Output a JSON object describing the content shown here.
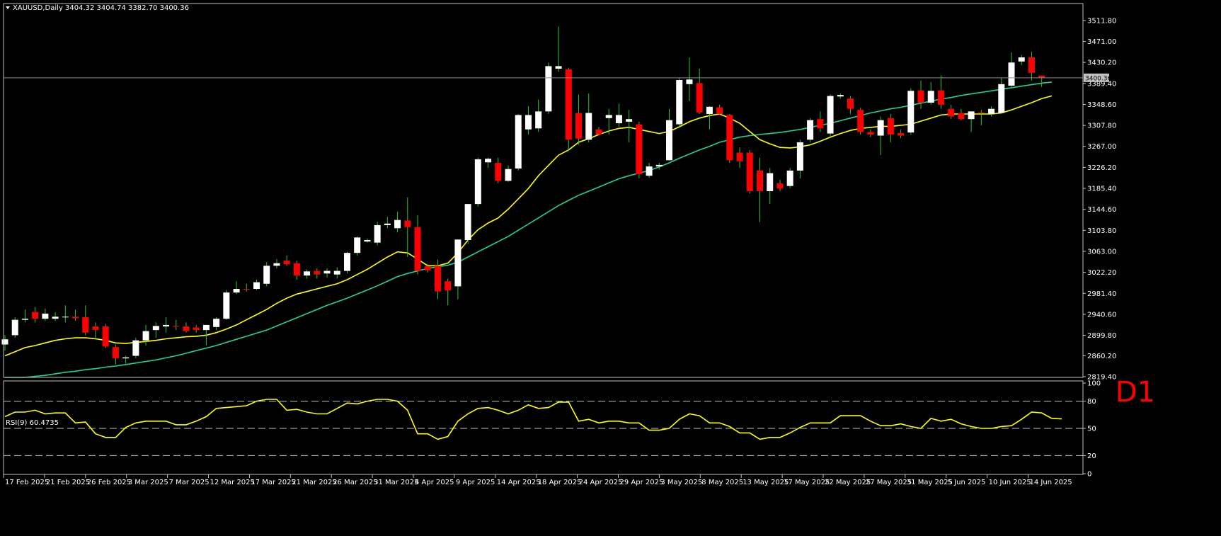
{
  "header": {
    "symbol": "XAUUSD,Daily",
    "ohlc": "3404.32 3404.74 3382.70 3400.36",
    "arrow_icon": "triangle-down-icon"
  },
  "timeframe_label": "D1",
  "current_price_label": "3400.36",
  "colors": {
    "background": "#000000",
    "bull_candle": "#ffffff",
    "bear_candle": "#ff0000",
    "wick": "#22cc22",
    "ma_fast": "#ffff00",
    "ma_slow": "#20d0a0",
    "rsi_line": "#ffff00",
    "grid_dash": "#c0c0c0",
    "border": "#c0c0c0",
    "timeframe_text": "#ff0000"
  },
  "chart_data": {
    "type": "candlestick",
    "title": "XAUUSD,Daily",
    "ylim": [
      2819.4,
      3524.0
    ],
    "y_ticks": [
      "3511.80",
      "3471.00",
      "3430.20",
      "3389.40",
      "3348.60",
      "3307.80",
      "3267.00",
      "3226.20",
      "3185.40",
      "3144.60",
      "3103.80",
      "3063.00",
      "3022.20",
      "2981.40",
      "2940.60",
      "2899.80",
      "2860.20",
      "2819.40"
    ],
    "x_ticks": [
      "17 Feb 2025",
      "21 Feb 2025",
      "26 Feb 2025",
      "3 Mar 2025",
      "7 Mar 2025",
      "12 Mar 2025",
      "17 Mar 2025",
      "21 Mar 2025",
      "26 Mar 2025",
      "31 Mar 2025",
      "4 Apr 2025",
      "9 Apr 2025",
      "14 Apr 2025",
      "18 Apr 2025",
      "24 Apr 2025",
      "29 Apr 2025",
      "3 May 2025",
      "8 May 2025",
      "13 May 2025",
      "17 May 2025",
      "22 May 2025",
      "27 May 2025",
      "31 May 2025",
      "5 Jun 2025",
      "10 Jun 2025",
      "14 Jun 2025"
    ],
    "candles": [
      {
        "o": 2882,
        "h": 2900,
        "l": 2870,
        "c": 2892
      },
      {
        "o": 2900,
        "h": 2935,
        "l": 2895,
        "c": 2930
      },
      {
        "o": 2930,
        "h": 2950,
        "l": 2925,
        "c": 2932
      },
      {
        "o": 2945,
        "h": 2955,
        "l": 2925,
        "c": 2932
      },
      {
        "o": 2932,
        "h": 2952,
        "l": 2928,
        "c": 2942
      },
      {
        "o": 2932,
        "h": 2945,
        "l": 2928,
        "c": 2936
      },
      {
        "o": 2935,
        "h": 2958,
        "l": 2925,
        "c": 2936
      },
      {
        "o": 2936,
        "h": 2950,
        "l": 2928,
        "c": 2933
      },
      {
        "o": 2935,
        "h": 2958,
        "l": 2900,
        "c": 2905
      },
      {
        "o": 2917,
        "h": 2925,
        "l": 2895,
        "c": 2910
      },
      {
        "o": 2917,
        "h": 2922,
        "l": 2875,
        "c": 2878
      },
      {
        "o": 2877,
        "h": 2882,
        "l": 2843,
        "c": 2855
      },
      {
        "o": 2855,
        "h": 2860,
        "l": 2845,
        "c": 2857
      },
      {
        "o": 2860,
        "h": 2895,
        "l": 2855,
        "c": 2890
      },
      {
        "o": 2890,
        "h": 2920,
        "l": 2880,
        "c": 2908
      },
      {
        "o": 2910,
        "h": 2925,
        "l": 2895,
        "c": 2918
      },
      {
        "o": 2917,
        "h": 2935,
        "l": 2905,
        "c": 2920
      },
      {
        "o": 2918,
        "h": 2930,
        "l": 2910,
        "c": 2917
      },
      {
        "o": 2917,
        "h": 2925,
        "l": 2905,
        "c": 2908
      },
      {
        "o": 2915,
        "h": 2920,
        "l": 2905,
        "c": 2910
      },
      {
        "o": 2910,
        "h": 2920,
        "l": 2880,
        "c": 2920
      },
      {
        "o": 2916,
        "h": 2935,
        "l": 2910,
        "c": 2932
      },
      {
        "o": 2932,
        "h": 2988,
        "l": 2930,
        "c": 2983
      },
      {
        "o": 2983,
        "h": 3005,
        "l": 2980,
        "c": 2990
      },
      {
        "o": 2990,
        "h": 3000,
        "l": 2985,
        "c": 2989
      },
      {
        "o": 2990,
        "h": 3008,
        "l": 2988,
        "c": 3003
      },
      {
        "o": 3000,
        "h": 3042,
        "l": 2995,
        "c": 3035
      },
      {
        "o": 3035,
        "h": 3048,
        "l": 3030,
        "c": 3040
      },
      {
        "o": 3045,
        "h": 3055,
        "l": 3035,
        "c": 3038
      },
      {
        "o": 3040,
        "h": 3045,
        "l": 3008,
        "c": 3016
      },
      {
        "o": 3016,
        "h": 3028,
        "l": 3010,
        "c": 3024
      },
      {
        "o": 3025,
        "h": 3030,
        "l": 3010,
        "c": 3018
      },
      {
        "o": 3020,
        "h": 3030,
        "l": 3012,
        "c": 3025
      },
      {
        "o": 3018,
        "h": 3032,
        "l": 3010,
        "c": 3025
      },
      {
        "o": 3025,
        "h": 3062,
        "l": 3020,
        "c": 3060
      },
      {
        "o": 3060,
        "h": 3092,
        "l": 3055,
        "c": 3090
      },
      {
        "o": 3082,
        "h": 3088,
        "l": 3080,
        "c": 3085
      },
      {
        "o": 3080,
        "h": 3120,
        "l": 3075,
        "c": 3114
      },
      {
        "o": 3114,
        "h": 3130,
        "l": 3108,
        "c": 3117
      },
      {
        "o": 3108,
        "h": 3140,
        "l": 3100,
        "c": 3124
      },
      {
        "o": 3123,
        "h": 3168,
        "l": 3052,
        "c": 3110
      },
      {
        "o": 3110,
        "h": 3133,
        "l": 3018,
        "c": 3025
      },
      {
        "o": 3034,
        "h": 3038,
        "l": 3022,
        "c": 3026
      },
      {
        "o": 3035,
        "h": 3047,
        "l": 2970,
        "c": 2985
      },
      {
        "o": 3005,
        "h": 3010,
        "l": 2958,
        "c": 2987
      },
      {
        "o": 2995,
        "h": 3050,
        "l": 2970,
        "c": 3086
      },
      {
        "o": 3085,
        "h": 3150,
        "l": 3078,
        "c": 3155
      },
      {
        "o": 3155,
        "h": 3245,
        "l": 3150,
        "c": 3242
      },
      {
        "o": 3236,
        "h": 3245,
        "l": 3225,
        "c": 3243
      },
      {
        "o": 3235,
        "h": 3245,
        "l": 3195,
        "c": 3200
      },
      {
        "o": 3200,
        "h": 3230,
        "l": 3198,
        "c": 3223
      },
      {
        "o": 3224,
        "h": 3330,
        "l": 3220,
        "c": 3328
      },
      {
        "o": 3300,
        "h": 3345,
        "l": 3290,
        "c": 3328
      },
      {
        "o": 3302,
        "h": 3358,
        "l": 3295,
        "c": 3335
      },
      {
        "o": 3335,
        "h": 3430,
        "l": 3330,
        "c": 3423
      },
      {
        "o": 3418,
        "h": 3500,
        "l": 3412,
        "c": 3423
      },
      {
        "o": 3417,
        "h": 3420,
        "l": 3260,
        "c": 3280
      },
      {
        "o": 3332,
        "h": 3368,
        "l": 3270,
        "c": 3282
      },
      {
        "o": 3280,
        "h": 3370,
        "l": 3275,
        "c": 3332
      },
      {
        "o": 3300,
        "h": 3305,
        "l": 3290,
        "c": 3290
      },
      {
        "o": 3322,
        "h": 3340,
        "l": 3290,
        "c": 3328
      },
      {
        "o": 3312,
        "h": 3350,
        "l": 3305,
        "c": 3328
      },
      {
        "o": 3315,
        "h": 3338,
        "l": 3275,
        "c": 3320
      },
      {
        "o": 3310,
        "h": 3315,
        "l": 3205,
        "c": 3213
      },
      {
        "o": 3210,
        "h": 3235,
        "l": 3206,
        "c": 3228
      },
      {
        "o": 3228,
        "h": 3235,
        "l": 3222,
        "c": 3231
      },
      {
        "o": 3240,
        "h": 3340,
        "l": 3240,
        "c": 3318
      },
      {
        "o": 3310,
        "h": 3400,
        "l": 3305,
        "c": 3396
      },
      {
        "o": 3388,
        "h": 3440,
        "l": 3355,
        "c": 3397
      },
      {
        "o": 3390,
        "h": 3418,
        "l": 3330,
        "c": 3333
      },
      {
        "o": 3330,
        "h": 3345,
        "l": 3300,
        "c": 3344
      },
      {
        "o": 3343,
        "h": 3348,
        "l": 3329,
        "c": 3330
      },
      {
        "o": 3328,
        "h": 3330,
        "l": 3235,
        "c": 3240
      },
      {
        "o": 3255,
        "h": 3265,
        "l": 3225,
        "c": 3238
      },
      {
        "o": 3255,
        "h": 3260,
        "l": 3175,
        "c": 3180
      },
      {
        "o": 3220,
        "h": 3245,
        "l": 3120,
        "c": 3180
      },
      {
        "o": 3180,
        "h": 3225,
        "l": 3155,
        "c": 3215
      },
      {
        "o": 3195,
        "h": 3202,
        "l": 3180,
        "c": 3185
      },
      {
        "o": 3190,
        "h": 3225,
        "l": 3186,
        "c": 3220
      },
      {
        "o": 3220,
        "h": 3280,
        "l": 3205,
        "c": 3275
      },
      {
        "o": 3280,
        "h": 3322,
        "l": 3275,
        "c": 3318
      },
      {
        "o": 3320,
        "h": 3335,
        "l": 3295,
        "c": 3302
      },
      {
        "o": 3292,
        "h": 3368,
        "l": 3285,
        "c": 3365
      },
      {
        "o": 3364,
        "h": 3370,
        "l": 3360,
        "c": 3367
      },
      {
        "o": 3360,
        "h": 3365,
        "l": 3330,
        "c": 3340
      },
      {
        "o": 3338,
        "h": 3342,
        "l": 3290,
        "c": 3295
      },
      {
        "o": 3295,
        "h": 3300,
        "l": 3285,
        "c": 3290
      },
      {
        "o": 3288,
        "h": 3325,
        "l": 3250,
        "c": 3318
      },
      {
        "o": 3322,
        "h": 3330,
        "l": 3275,
        "c": 3290
      },
      {
        "o": 3293,
        "h": 3300,
        "l": 3283,
        "c": 3288
      },
      {
        "o": 3294,
        "h": 3380,
        "l": 3290,
        "c": 3375
      },
      {
        "o": 3376,
        "h": 3395,
        "l": 3340,
        "c": 3352
      },
      {
        "o": 3352,
        "h": 3392,
        "l": 3348,
        "c": 3375
      },
      {
        "o": 3376,
        "h": 3405,
        "l": 3340,
        "c": 3348
      },
      {
        "o": 3340,
        "h": 3348,
        "l": 3320,
        "c": 3325
      },
      {
        "o": 3332,
        "h": 3340,
        "l": 3318,
        "c": 3320
      },
      {
        "o": 3320,
        "h": 3330,
        "l": 3295,
        "c": 3335
      },
      {
        "o": 3333,
        "h": 3338,
        "l": 3308,
        "c": 3332
      },
      {
        "o": 3330,
        "h": 3345,
        "l": 3325,
        "c": 3340
      },
      {
        "o": 3332,
        "h": 3400,
        "l": 3330,
        "c": 3388
      },
      {
        "o": 3385,
        "h": 3450,
        "l": 3380,
        "c": 3430
      },
      {
        "o": 3432,
        "h": 3445,
        "l": 3425,
        "c": 3440
      },
      {
        "o": 3440,
        "h": 3451,
        "l": 3395,
        "c": 3410
      },
      {
        "o": 3404.32,
        "h": 3404.74,
        "l": 3382.7,
        "c": 3400.36
      }
    ],
    "series": [
      {
        "name": "MA fast",
        "values": [
          2860,
          2868,
          2876,
          2880,
          2885,
          2890,
          2893,
          2895,
          2895,
          2893,
          2890,
          2885,
          2884,
          2886,
          2888,
          2890,
          2893,
          2895,
          2897,
          2898,
          2900,
          2905,
          2912,
          2920,
          2930,
          2940,
          2950,
          2962,
          2972,
          2980,
          2985,
          2990,
          2995,
          3000,
          3008,
          3018,
          3028,
          3040,
          3052,
          3062,
          3060,
          3048,
          3035,
          3035,
          3040,
          3060,
          3085,
          3105,
          3118,
          3128,
          3145,
          3165,
          3185,
          3210,
          3230,
          3250,
          3260,
          3275,
          3282,
          3290,
          3297,
          3302,
          3304,
          3300,
          3296,
          3292,
          3296,
          3305,
          3315,
          3322,
          3327,
          3330,
          3322,
          3312,
          3296,
          3280,
          3272,
          3265,
          3264,
          3266,
          3270,
          3277,
          3285,
          3292,
          3298,
          3302,
          3304,
          3306,
          3306,
          3308,
          3310,
          3316,
          3322,
          3328,
          3330,
          3330,
          3330,
          3330,
          3330,
          3332,
          3338,
          3345,
          3352,
          3360,
          3365
        ]
      },
      {
        "name": "MA slow",
        "values": [
          2812,
          2815,
          2818,
          2820,
          2822,
          2825,
          2828,
          2830,
          2833,
          2835,
          2838,
          2840,
          2843,
          2846,
          2849,
          2852,
          2856,
          2860,
          2865,
          2870,
          2875,
          2880,
          2886,
          2892,
          2898,
          2904,
          2910,
          2918,
          2926,
          2934,
          2942,
          2950,
          2958,
          2965,
          2972,
          2980,
          2988,
          2996,
          3005,
          3014,
          3020,
          3025,
          3030,
          3033,
          3036,
          3042,
          3052,
          3062,
          3072,
          3082,
          3092,
          3104,
          3116,
          3128,
          3140,
          3152,
          3162,
          3172,
          3180,
          3188,
          3196,
          3204,
          3210,
          3215,
          3220,
          3227,
          3235,
          3244,
          3252,
          3260,
          3267,
          3275,
          3280,
          3285,
          3288,
          3290,
          3292,
          3294,
          3297,
          3300,
          3304,
          3308,
          3312,
          3317,
          3322,
          3327,
          3332,
          3336,
          3340,
          3343,
          3347,
          3351,
          3355,
          3359,
          3362,
          3366,
          3369,
          3372,
          3375,
          3378,
          3381,
          3384,
          3387,
          3390,
          3392
        ]
      }
    ],
    "rsi": {
      "label": "RSI(9) 60.4735",
      "levels": [
        "100",
        "80",
        "50",
        "20",
        "0"
      ],
      "values": [
        63,
        68,
        68,
        70,
        66,
        67,
        67,
        56,
        57,
        44,
        40,
        40,
        51,
        56,
        58,
        58,
        58,
        54,
        54,
        58,
        63,
        72,
        73,
        74,
        75,
        80,
        82,
        82,
        70,
        71,
        68,
        66,
        66,
        72,
        78,
        77,
        80,
        82,
        82,
        80,
        70,
        44,
        44,
        38,
        41,
        58,
        66,
        72,
        73,
        70,
        66,
        70,
        76,
        72,
        73,
        79,
        79,
        58,
        60,
        56,
        58,
        58,
        56,
        56,
        48,
        48,
        50,
        60,
        66,
        64,
        56,
        56,
        52,
        45,
        45,
        38,
        40,
        40,
        45,
        51,
        56,
        56,
        56,
        64,
        64,
        64,
        58,
        53,
        53,
        55,
        52,
        50,
        61,
        58,
        60,
        55,
        52,
        50,
        50,
        52,
        53,
        60,
        68,
        67,
        61,
        60.47
      ]
    }
  }
}
